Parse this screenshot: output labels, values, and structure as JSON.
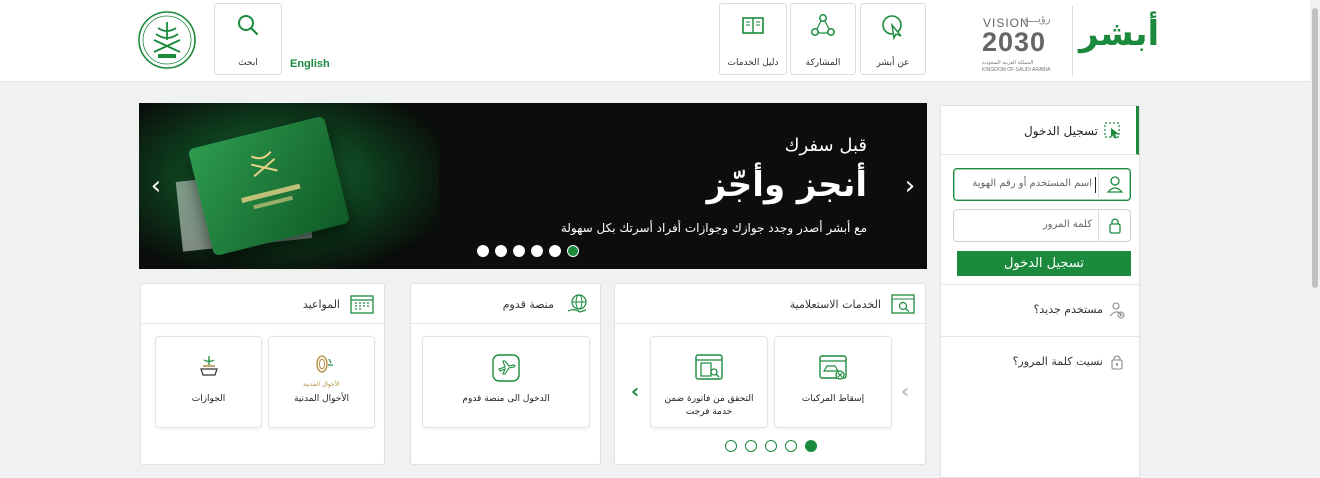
{
  "header": {
    "search_label": "ابحث",
    "language_label": "English",
    "nav": [
      {
        "label": "دليل الخدمات"
      },
      {
        "label": "المشاركة"
      },
      {
        "label": "عن أبشر"
      }
    ],
    "vision": {
      "top_ar": "رؤيـــة",
      "top_en": "VISION",
      "year": "2030",
      "kingdom_ar": "المملكة العربية السعودية",
      "kingdom_en": "KINGDOM OF SAUDI ARABIA"
    },
    "logo_text": "أبشر"
  },
  "hero": {
    "line1": "قبل سفرك",
    "line2": "أنجز وأجّز",
    "line3": "مع أبشر أصدر وجدد جوازك وجوازات أفراد أسرتك بكل سهولة",
    "dots": 6,
    "active_dot": 5
  },
  "login": {
    "title": "تسجيل الدخول",
    "username_placeholder": "اسم المستخدم أو رقم الهوية",
    "password_placeholder": "كلمة المرور",
    "button": "تسجيل الدخول",
    "new_user": "مستخدم جديد؟",
    "forgot_password": "نسيت كلمة المرور؟"
  },
  "cards": {
    "inquiry": {
      "title": "الخدمات الاستعلامية",
      "tiles": [
        {
          "label": "إسقاط المركبات"
        },
        {
          "label": "التحقق من فاتورة ضمن خدمة فرجت"
        }
      ],
      "dots": 5,
      "active_dot": 4
    },
    "qudoom": {
      "title": "منصة قدوم",
      "tiles": [
        {
          "label": "الدخول الى منصة قدوم"
        }
      ]
    },
    "appointments": {
      "title": "المواعيد",
      "tiles": [
        {
          "label": "الأحوال المدنية",
          "sublabel": "الأحوال المدنية"
        },
        {
          "label": "الجوازات"
        }
      ]
    }
  },
  "colors": {
    "brand": "#1b8a3d",
    "hero_bg": "#0c0e0c",
    "page_bg": "#f0f1f1"
  }
}
